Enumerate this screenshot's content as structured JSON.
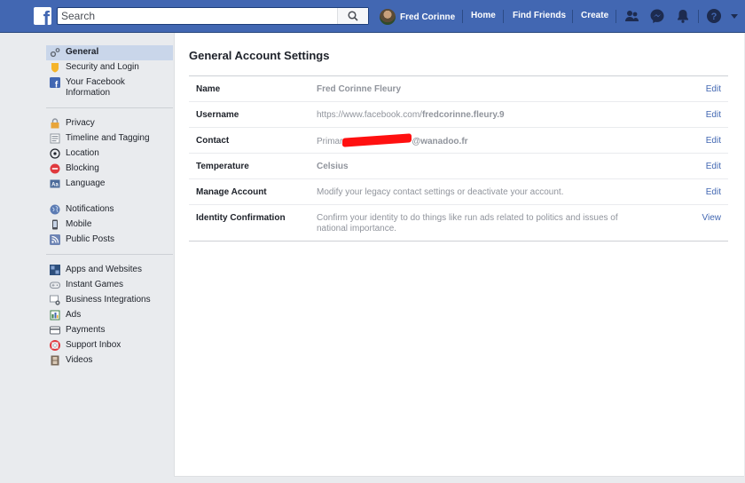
{
  "header": {
    "logo_letter": "f",
    "search_placeholder": "Search",
    "user_name": "Fred Corinne",
    "links": [
      "Home",
      "Find Friends",
      "Create"
    ],
    "brand_color": "#4267b2"
  },
  "sidebar": {
    "groups": [
      [
        {
          "label": "General",
          "icon": "gear-icon",
          "active": true
        },
        {
          "label": "Security and Login",
          "icon": "shield-icon"
        },
        {
          "label": "Your Facebook Information",
          "icon": "facebook-icon"
        }
      ],
      [
        {
          "label": "Privacy",
          "icon": "lock-icon"
        },
        {
          "label": "Timeline and Tagging",
          "icon": "timeline-icon"
        },
        {
          "label": "Location",
          "icon": "location-icon"
        },
        {
          "label": "Blocking",
          "icon": "block-icon"
        },
        {
          "label": "Language",
          "icon": "language-icon"
        }
      ],
      [
        {
          "label": "Notifications",
          "icon": "globe-icon"
        },
        {
          "label": "Mobile",
          "icon": "mobile-icon"
        },
        {
          "label": "Public Posts",
          "icon": "rss-icon"
        }
      ],
      [
        {
          "label": "Apps and Websites",
          "icon": "apps-icon"
        },
        {
          "label": "Instant Games",
          "icon": "gamepad-icon"
        },
        {
          "label": "Business Integrations",
          "icon": "business-icon"
        },
        {
          "label": "Ads",
          "icon": "ads-icon"
        },
        {
          "label": "Payments",
          "icon": "credit-card-icon"
        },
        {
          "label": "Support Inbox",
          "icon": "lifebuoy-icon"
        },
        {
          "label": "Videos",
          "icon": "film-icon"
        }
      ]
    ]
  },
  "main": {
    "title": "General Account Settings",
    "rows": [
      {
        "label": "Name",
        "value": "Fred Corinne Fleury",
        "action": "Edit"
      },
      {
        "label": "Username",
        "value": "https://www.facebook.com/",
        "value_bold": "fredcorinne.fleury.9",
        "action": "Edit"
      },
      {
        "label": "Contact",
        "value": "Primar",
        "value_bold": "@wanadoo.fr",
        "action": "Edit"
      },
      {
        "label": "Temperature",
        "value": "Celsius",
        "action": "Edit"
      },
      {
        "label": "Manage Account",
        "value": "Modify your legacy contact settings or deactivate your account.",
        "action": "Edit"
      },
      {
        "label": "Identity Confirmation",
        "value": "Confirm your identity to do things like run ads related to politics and issues of national importance.",
        "action": "View"
      }
    ]
  }
}
